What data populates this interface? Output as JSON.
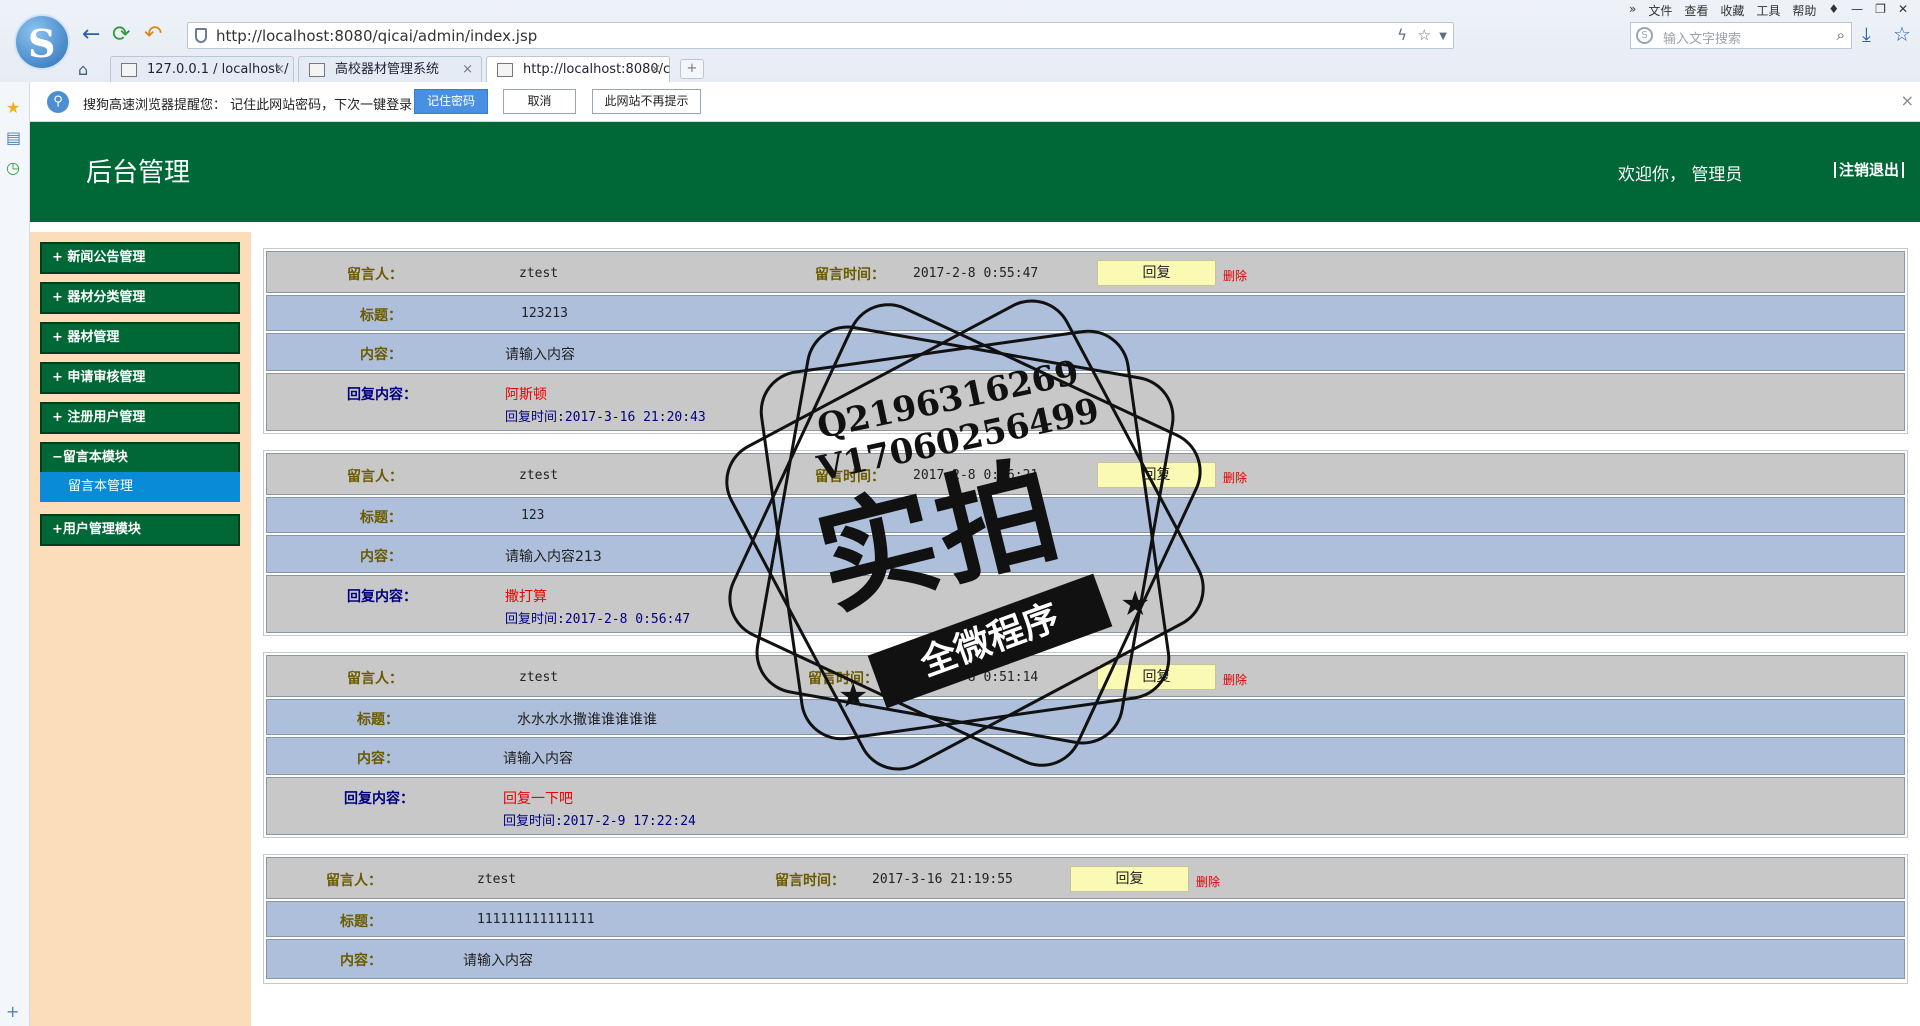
{
  "browser": {
    "url": "http://localhost:8080/qicai/admin/index.jsp",
    "search_placeholder": "输入文字搜索",
    "menu": [
      "文件",
      "查看",
      "收藏",
      "工具",
      "帮助"
    ],
    "tabs": [
      "127.0.0.1 / localhost /",
      "高校器材管理系统",
      "http://localhost:8080/c"
    ]
  },
  "notice": {
    "message": "搜狗高速浏览器提醒您： 记住此网站密码，下次一键登录！",
    "remember": "记住密码",
    "cancel": "取消",
    "never": "此网站不再提示"
  },
  "header": {
    "title": "后台管理",
    "welcome": "欢迎你，  管理员",
    "logout": "注销退出"
  },
  "menu": {
    "items": [
      "+  新闻公告管理",
      "+  器材分类管理",
      "+  器材管理",
      "+  申请审核管理",
      "+  注册用户管理",
      "−留言本模块",
      "+用户管理模块"
    ],
    "sub": "留言本管理"
  },
  "labels": {
    "author": "留言人：",
    "time": "留言时间：",
    "title": "标题：",
    "content": "内容：",
    "reply": "回复内容：",
    "reply_btn": "回复",
    "delete": "删除"
  },
  "messages": [
    {
      "author": "ztest",
      "time": "2017-2-8 0:55:47",
      "title": "123213",
      "content": "请输入内容",
      "reply": "阿斯顿",
      "reply_time": "回复时间:2017-3-16 21:20:43"
    },
    {
      "author": "ztest",
      "time": "2017-2-8 0:56:21",
      "title": "123",
      "content": "请输入内容213",
      "reply": "撒打算",
      "reply_time": "回复时间:2017-2-8 0:56:47"
    },
    {
      "author": "ztest",
      "time": "2017-2-8 0:51:14",
      "title": "水水水水撒谁谁谁谁谁",
      "content": "请输入内容",
      "reply": "回复一下吧",
      "reply_time": "回复时间:2017-2-9 17:22:24"
    },
    {
      "author": "ztest",
      "time": "2017-3-16 21:19:55",
      "title": "111111111111111",
      "content": "请输入内容"
    }
  ],
  "watermark": {
    "line1": "Q2196316269",
    "line2": "V17060256499",
    "big": "实拍",
    "band": "全微程序"
  }
}
